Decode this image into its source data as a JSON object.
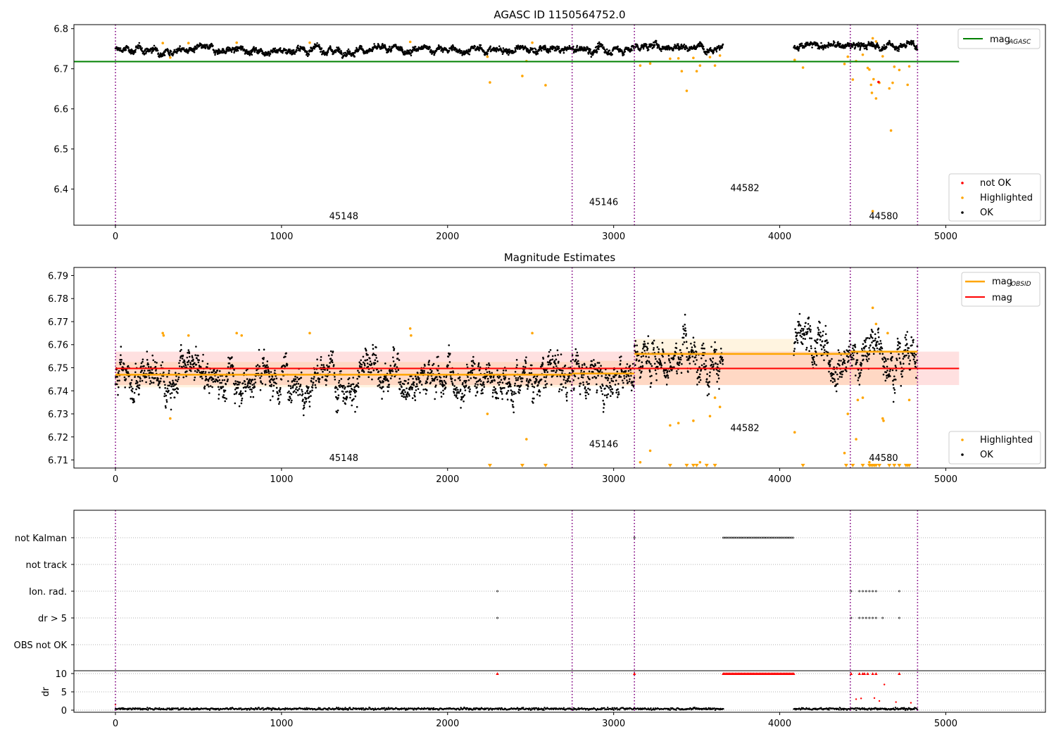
{
  "figure": {
    "title_top": "AGASC ID 1150564752.0",
    "title_mid": "Magnitude Estimates"
  },
  "colors": {
    "ok": "#000000",
    "highlighted": "#ffa500",
    "not_ok": "#ff0000",
    "agasc_line": "#008000",
    "obsid_line": "#ffa500",
    "mag_line": "#ff0000",
    "obsid_vline": "#800080"
  },
  "chart_data": [
    {
      "type": "scatter",
      "title": "AGASC ID 1150564752.0",
      "xlim": [
        -250,
        5600
      ],
      "ylim": [
        6.31,
        6.81
      ],
      "x_ticks": [
        0,
        1000,
        2000,
        3000,
        4000,
        5000
      ],
      "y_ticks": [
        6.4,
        6.5,
        6.6,
        6.7,
        6.8
      ],
      "y_tick_labels": [
        "6.4",
        "6.5",
        "6.6",
        "6.7",
        "6.8"
      ],
      "grid": false,
      "obsid_boundaries": [
        0,
        2750,
        3125,
        4425,
        4830
      ],
      "obsid_labels": [
        {
          "text": "45148",
          "x": 1375,
          "y": 6.325
        },
        {
          "text": "45146",
          "x": 2940,
          "y": 6.36
        },
        {
          "text": "44582",
          "x": 3790,
          "y": 6.395
        },
        {
          "text": "44580",
          "x": 4625,
          "y": 6.325
        }
      ],
      "mag_agasc": 6.718,
      "mag_agasc_xrange": [
        -250,
        5080
      ],
      "ok_segments": [
        {
          "x": [
            0,
            2750
          ],
          "mean": 6.747,
          "spread": 0.006
        },
        {
          "x": [
            2750,
            3125
          ],
          "mean": 6.748,
          "spread": 0.007
        },
        {
          "x": [
            3125,
            3660
          ],
          "mean": 6.756,
          "spread": 0.006
        },
        {
          "x": [
            4085,
            4425
          ],
          "mean": 6.757,
          "spread": 0.006
        },
        {
          "x": [
            4425,
            4830
          ],
          "mean": 6.757,
          "spread": 0.006
        }
      ],
      "highlighted_points": [
        [
          285,
          6.764
        ],
        [
          330,
          6.728
        ],
        [
          440,
          6.764
        ],
        [
          730,
          6.765
        ],
        [
          1170,
          6.765
        ],
        [
          1775,
          6.767
        ],
        [
          2240,
          6.73
        ],
        [
          2255,
          6.666
        ],
        [
          2450,
          6.682
        ],
        [
          2590,
          6.659
        ],
        [
          2475,
          6.719
        ],
        [
          2510,
          6.765
        ],
        [
          3160,
          6.708
        ],
        [
          3220,
          6.713
        ],
        [
          3340,
          6.725
        ],
        [
          3390,
          6.726
        ],
        [
          3410,
          6.694
        ],
        [
          3440,
          6.645
        ],
        [
          3480,
          6.727
        ],
        [
          3500,
          6.694
        ],
        [
          3520,
          6.708
        ],
        [
          3580,
          6.729
        ],
        [
          3610,
          6.708
        ],
        [
          3640,
          6.733
        ],
        [
          4090,
          6.722
        ],
        [
          4140,
          6.703
        ],
        [
          4390,
          6.712
        ],
        [
          4410,
          6.73
        ],
        [
          4440,
          6.673
        ],
        [
          4460,
          6.719
        ],
        [
          4500,
          6.735
        ],
        [
          4530,
          6.702
        ],
        [
          4540,
          6.698
        ],
        [
          4550,
          6.66
        ],
        [
          4555,
          6.64
        ],
        [
          4565,
          6.674
        ],
        [
          4580,
          6.626
        ],
        [
          4600,
          6.665
        ],
        [
          4620,
          6.731
        ],
        [
          4660,
          6.651
        ],
        [
          4680,
          6.665
        ],
        [
          4690,
          6.705
        ],
        [
          4720,
          6.697
        ],
        [
          4770,
          6.66
        ],
        [
          4780,
          6.706
        ],
        [
          4560,
          6.776
        ],
        [
          4580,
          6.768
        ],
        [
          4670,
          6.546
        ],
        [
          4560,
          6.345
        ]
      ],
      "not_ok_points": [
        [
          4595,
          6.667
        ]
      ],
      "legend": {
        "line": {
          "base": "mag",
          "sub": "AGASC"
        },
        "scatter": [
          "not OK",
          "Highlighted",
          "OK"
        ]
      }
    },
    {
      "type": "scatter",
      "title": "Magnitude Estimates",
      "xlim": [
        -250,
        5600
      ],
      "ylim": [
        6.7065,
        6.7935
      ],
      "x_ticks": [
        0,
        1000,
        2000,
        3000,
        4000,
        5000
      ],
      "y_ticks": [
        6.71,
        6.72,
        6.73,
        6.74,
        6.75,
        6.76,
        6.77,
        6.78,
        6.79
      ],
      "y_tick_labels": [
        "6.71",
        "6.72",
        "6.73",
        "6.74",
        "6.75",
        "6.76",
        "6.77",
        "6.78",
        "6.79"
      ],
      "grid": false,
      "obsid_boundaries": [
        0,
        2750,
        3125,
        4425,
        4830
      ],
      "obsid_labels": [
        {
          "text": "45148",
          "x": 1375,
          "y": 6.7095
        },
        {
          "text": "45146",
          "x": 2940,
          "y": 6.7155
        },
        {
          "text": "44582",
          "x": 3790,
          "y": 6.7225
        },
        {
          "text": "44580",
          "x": 4625,
          "y": 6.7095
        }
      ],
      "mag": 6.7497,
      "mag_band": [
        6.7425,
        6.757
      ],
      "mag_xrange": [
        0,
        5080
      ],
      "mag_obsid": [
        {
          "x": [
            0,
            2750
          ],
          "value": 6.747,
          "band": [
            6.7415,
            6.7525
          ]
        },
        {
          "x": [
            2750,
            3125
          ],
          "value": 6.7475,
          "band": [
            6.742,
            6.753
          ]
        },
        {
          "x": [
            3125,
            3660
          ],
          "value": 6.756,
          "band": [
            6.7425,
            6.7625
          ]
        },
        {
          "x": [
            3660,
            4085
          ],
          "value": 6.756,
          "band": [
            6.7425,
            6.7625
          ]
        },
        {
          "x": [
            4085,
            4425
          ],
          "value": 6.756,
          "band": [
            6.7425,
            6.757
          ]
        },
        {
          "x": [
            4425,
            4830
          ],
          "value": 6.757,
          "band": [
            6.7425,
            6.757
          ]
        }
      ],
      "ok_segments": [
        {
          "x": [
            0,
            2750
          ],
          "mean": 6.747,
          "spread": 0.0058
        },
        {
          "x": [
            2750,
            3125
          ],
          "mean": 6.748,
          "spread": 0.0065
        },
        {
          "x": [
            3125,
            3660
          ],
          "mean": 6.756,
          "spread": 0.006
        },
        {
          "x": [
            4085,
            4425
          ],
          "mean": 6.757,
          "spread": 0.0058
        },
        {
          "x": [
            4425,
            4830
          ],
          "mean": 6.757,
          "spread": 0.0058
        }
      ],
      "highlighted_points": [
        [
          285,
          6.765
        ],
        [
          290,
          6.764
        ],
        [
          330,
          6.728
        ],
        [
          440,
          6.764
        ],
        [
          730,
          6.765
        ],
        [
          760,
          6.764
        ],
        [
          1170,
          6.765
        ],
        [
          1775,
          6.767
        ],
        [
          1780,
          6.764
        ],
        [
          2240,
          6.73
        ],
        [
          2475,
          6.719
        ],
        [
          2510,
          6.765
        ],
        [
          3160,
          6.709
        ],
        [
          3220,
          6.714
        ],
        [
          3340,
          6.725
        ],
        [
          3390,
          6.726
        ],
        [
          3480,
          6.727
        ],
        [
          3520,
          6.709
        ],
        [
          3580,
          6.729
        ],
        [
          3610,
          6.737
        ],
        [
          3640,
          6.733
        ],
        [
          4090,
          6.722
        ],
        [
          4410,
          6.73
        ],
        [
          4390,
          6.713
        ],
        [
          4460,
          6.719
        ],
        [
          4470,
          6.736
        ],
        [
          4500,
          6.737
        ],
        [
          4540,
          6.709
        ],
        [
          4560,
          6.776
        ],
        [
          4580,
          6.769
        ],
        [
          4620,
          6.728
        ],
        [
          4625,
          6.727
        ],
        [
          4780,
          6.736
        ],
        [
          4650,
          6.765
        ]
      ],
      "below_range_markers": [
        2255,
        2450,
        2590,
        3340,
        3440,
        3480,
        3500,
        3560,
        3610,
        4140,
        4400,
        4440,
        4500,
        4540,
        4550,
        4560,
        4570,
        4580,
        4600,
        4660,
        4690,
        4720,
        4760,
        4770,
        4780
      ],
      "legend": {
        "lines": [
          {
            "base": "mag",
            "sub": "OBSID"
          },
          {
            "base": "mag",
            "sub": ""
          }
        ],
        "scatter": [
          "Highlighted",
          "OK"
        ]
      }
    },
    {
      "type": "scatter",
      "xlim": [
        -250,
        5600
      ],
      "x_ticks": [
        0,
        1000,
        2000,
        3000,
        4000,
        5000
      ],
      "obsid_boundaries": [
        0,
        2750,
        3125,
        4425,
        4830
      ],
      "flag_rows": [
        "not Kalman",
        "not track",
        "Ion. rad.",
        "dr > 5",
        "OBS not OK"
      ],
      "flag_events": {
        "not Kalman": {
          "range": [
            3660,
            4085
          ],
          "points": [
            3125
          ]
        },
        "not track": {
          "range": null,
          "points": []
        },
        "Ion. rad.": {
          "range": null,
          "points": [
            2300,
            4430,
            4480,
            4500,
            4520,
            4540,
            4560,
            4580,
            4720
          ]
        },
        "dr > 5": {
          "range": null,
          "points": [
            2300,
            4430,
            4480,
            4500,
            4520,
            4540,
            4560,
            4580,
            4620,
            4720
          ]
        },
        "OBS not OK": {
          "range": null,
          "points": []
        }
      },
      "dr": {
        "ylabel": "dr",
        "ylim": [
          -0.5,
          10.5
        ],
        "y_ticks": [
          0,
          5,
          10
        ],
        "y_tick_labels": [
          "0",
          "5",
          "10"
        ],
        "clipped_value": 10,
        "baseline_segments": [
          [
            0,
            3660
          ],
          [
            4085,
            4830
          ]
        ],
        "clipped_ranges": [
          [
            3660,
            4085
          ]
        ],
        "clipped_points": [
          2300,
          3125,
          4430,
          4480,
          4500,
          4510,
          4530,
          4560,
          4580,
          4720
        ],
        "spike_points": [
          [
            0,
            1.5
          ],
          [
            4460,
            3.0
          ],
          [
            4490,
            3.2
          ],
          [
            4570,
            3.3
          ],
          [
            4600,
            2.5
          ],
          [
            4630,
            7.0
          ],
          [
            4700,
            2.2
          ],
          [
            4790,
            2.0
          ]
        ]
      }
    }
  ]
}
